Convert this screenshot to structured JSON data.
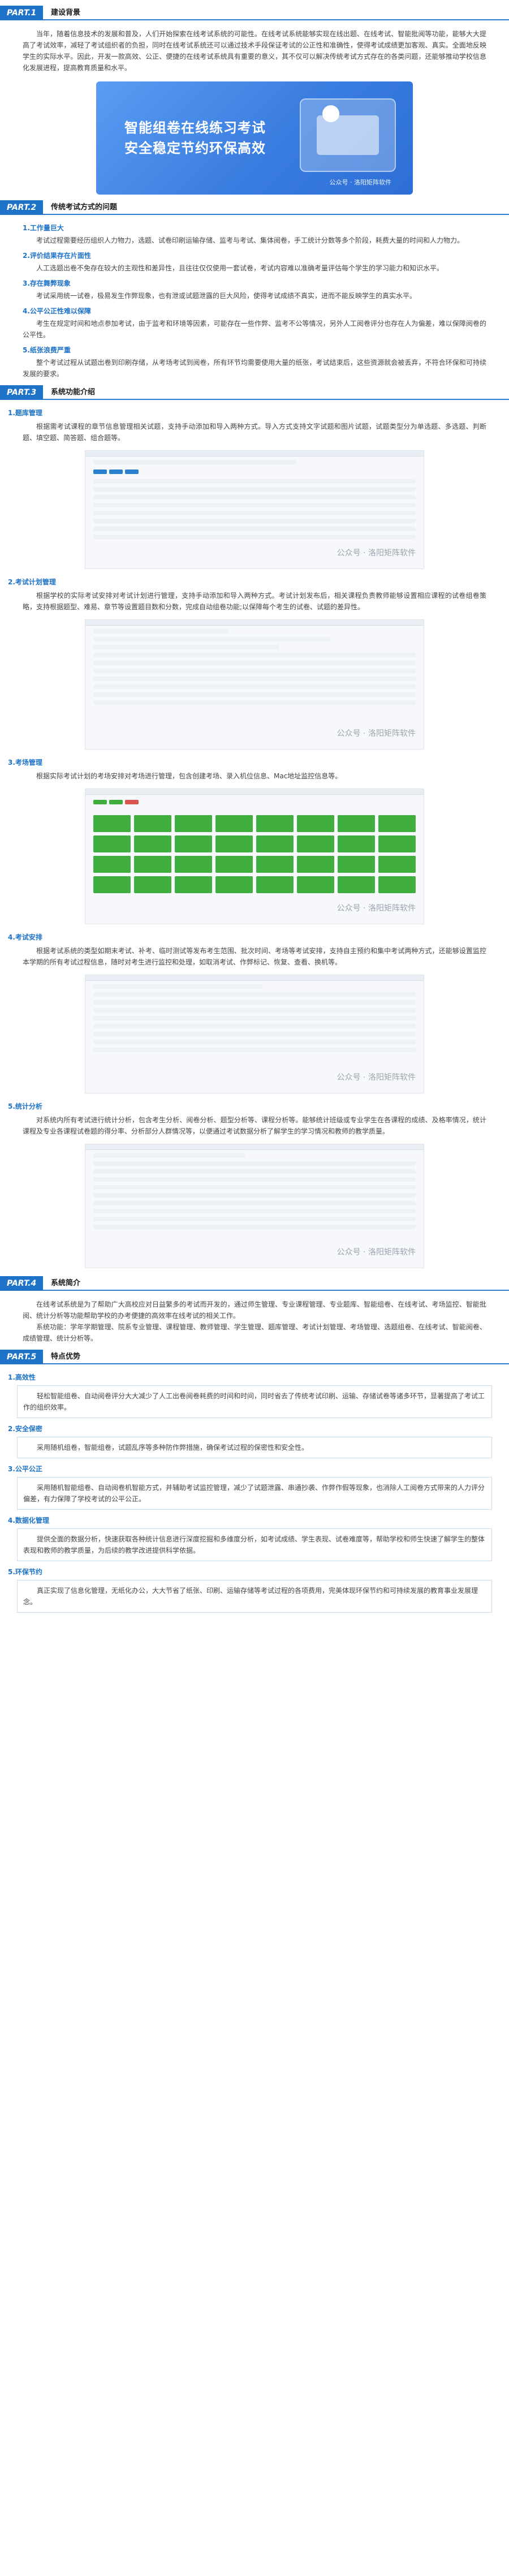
{
  "part1": {
    "tag": "PART.1",
    "title": "建设背景",
    "para": "当年，随着信息技术的发展和普及，人们开始探索在线考试系统的可能性。在线考试系统能够实现在线出题、在线考试、智能批阅等功能，能够大大提高了考试效率，减轻了考试组织者的负担，同时在线考试系统还可以通过技术手段保证考试的公正性和准确性，使得考试成绩更加客观、真实。全面地反映学生的实际水平。因此，开发一款高效、公正、便捷的在线考试系统具有重要的意义，其不仅可以解决传统考试方式存在的各类问题，还能够推动学校信息化发展进程，提高教育质量和水平。",
    "banner_line1": "智能组卷在线练习考试",
    "banner_line2": "安全稳定节约环保高效",
    "banner_watermark": "公众号 · 洛阳矩阵软件"
  },
  "part2": {
    "tag": "PART.2",
    "title": "传统考试方式的问题",
    "items": [
      {
        "title": "1.工作量巨大",
        "text": "考试过程需要经历组织人力物力，选题、试卷印刷运输存储、监考与考试、集体阅卷，手工统计分数等多个阶段，耗费大量的时间和人力物力。"
      },
      {
        "title": "2.评价结果存在片面性",
        "text": "人工选题出卷不免存在较大的主观性和差异性，且往往仅仅使用一套试卷，考试内容难以准确考量评估每个学生的学习能力和知识水平。"
      },
      {
        "title": "3.存在舞弊现象",
        "text": "考试采用统一试卷，极易发生作弊现象，也有泄或试题泄露的巨大风险，使得考试成绩不真实，进而不能反映学生的真实水平。"
      },
      {
        "title": "4.公平公正性难以保障",
        "text": "考生在规定时间和地点参加考试，由于监考和环境等因素，可能存在一些作弊、监考不公等情况，另外人工阅卷评分也存在人为偏差，难以保障阅卷的公平性。"
      },
      {
        "title": "5.纸张浪费严重",
        "text": "整个考试过程从试题出卷到印刷存储，从考场考试到阅卷，所有环节均需要使用大量的纸张，考试结束后，这些资源就会被丢弃，不符合环保和可持续发展的要求。"
      }
    ]
  },
  "part3": {
    "tag": "PART.3",
    "title": "系统功能介绍",
    "items": [
      {
        "title": "1.题库管理",
        "text": "根据需考试课程的章节信息管理相关试题，支持手动添加和导入两种方式。导入方式支持文字试题和图片试题，试题类型分为单选题、多选题、判断题、填空题、简答题、组合题等。",
        "watermark": "公众号 · 洛阳矩阵软件"
      },
      {
        "title": "2.考试计划管理",
        "text": "根据学校的实际考试安排对考试计划进行管理，支持手动添加和导入两种方式。考试计划发布后，相关课程负责教师能够设置相应课程的试卷组卷策略，支持根据题型、难易、章节等设置题目数和分数，完成自动组卷功能;以保障每个考生的试卷、试题的差异性。",
        "watermark": "公众号 · 洛阳矩阵软件"
      },
      {
        "title": "3.考场管理",
        "text": "根据实际考试计划的考场安排对考场进行管理，包含创建考场、录入机位信息、Mac地址监控信息等。",
        "watermark": "公众号 · 洛阳矩阵软件"
      },
      {
        "title": "4.考试安排",
        "text": "根据考试系统的类型如期末考试、补考、临时测试等发布考生范围、批次时间、考场等考试安排，支持自主预约和集中考试两种方式，还能够设置监控本学期的所有考试过程信息，随时对考生进行监控和处理，如取消考试、作弊标记、恢复、查看、换机等。",
        "watermark": "公众号 · 洛阳矩阵软件"
      },
      {
        "title": "5.统计分析",
        "text": "对系统内所有考试进行统计分析，包含考生分析、阅卷分析、题型分析等、课程分析等。能够统计班级或专业学生在各课程的成绩、及格率情况，统计课程及专业各课程试卷题的得分率、分析部分人群情况等，以便通过考试数据分析了解学生的学习情况和教师的教学质量。",
        "watermark": "公众号 · 洛阳矩阵软件"
      }
    ]
  },
  "part4": {
    "tag": "PART.4",
    "title": "系统简介",
    "paras": [
      "在线考试系统是为了帮助广大高校应对日益繁多的考试而开发的，通过师生管理、专业课程管理、专业题库、智能组卷、在线考试、考场监控、智能批阅、统计分析等功能帮助学校的办考便捷的高效率在线考试的相关工作。",
      "系统功能：学年学期管理、院系专业管理、课程管理、教师管理、学生管理、题库管理、考试计划管理、考场管理、选题组卷、在线考试、智能阅卷、成绩管理、统计分析等。"
    ]
  },
  "part5": {
    "tag": "PART.5",
    "title": "特点优势",
    "items": [
      {
        "title": "1.高效性",
        "text": "轻松智能组卷、自动阅卷评分大大减少了人工出卷阅卷耗费的时间和时间，同时省去了传统考试印刷、运输、存储试卷等诸多环节，显著提高了考试工作的组织效率。"
      },
      {
        "title": "2.安全保密",
        "text": "采用随机组卷，智能组卷，试题乱序等多种防作弊措施，确保考试过程的保密性和安全性。"
      },
      {
        "title": "3.公平公正",
        "text": "采用随机智能组卷、自动阅卷机智能方式，并辅助考试监控管理，减少了试题泄露、串通抄袭、作弊作假等现象，也消除人工阅卷方式带来的人力评分偏差，有力保障了学校考试的公平公正。"
      },
      {
        "title": "4.数据化管理",
        "text": "提供全面的数据分析，快速获取各种统计信息进行深度挖掘和多维度分析，如考试成绩、学生表现、试卷难度等，帮助学校和师生快速了解学生的整体表现和教师的教学质量，为后续的教学改进提供科学依据。"
      },
      {
        "title": "5.环保节约",
        "text": "真正实现了信息化管理，无纸化办公，大大节省了纸张、印刷、运输存储等考试过程的各项费用，完美体现环保节约和可持续发展的教育事业发展理念。"
      }
    ]
  }
}
